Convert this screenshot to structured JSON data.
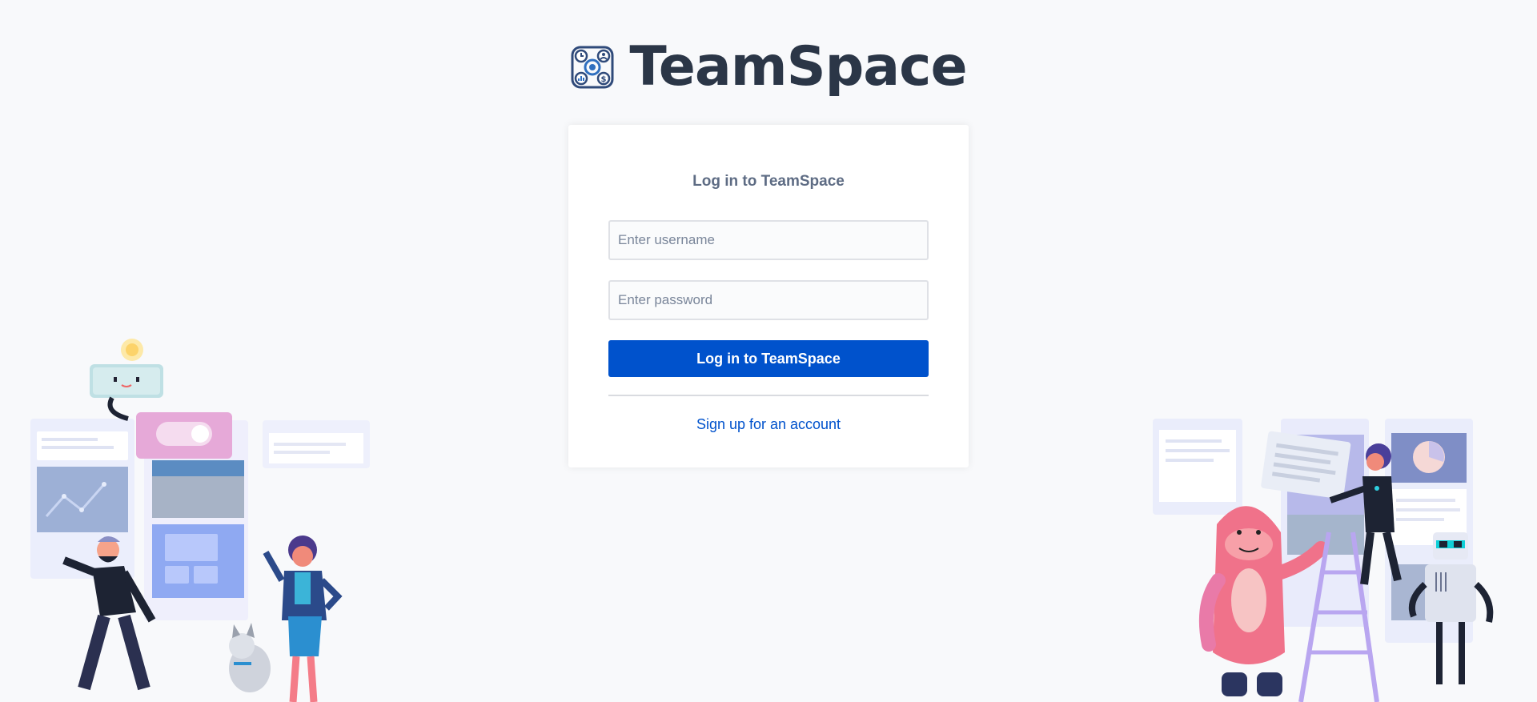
{
  "header": {
    "brand": "TeamSpace",
    "logo_icon": "teamspace-logo-icon"
  },
  "login": {
    "title": "Log in to TeamSpace",
    "username_placeholder": "Enter username",
    "username_value": "",
    "password_placeholder": "Enter password",
    "password_value": "",
    "submit_label": "Log in to TeamSpace",
    "signup_link": "Sign up for an account"
  },
  "colors": {
    "background": "#f8f9fb",
    "brand_text": "#2b3647",
    "primary_button": "#0052cc",
    "link": "#0052cc",
    "title": "#5e6c84"
  },
  "illustrations": {
    "left": "team-collaboration-illustration-left",
    "right": "team-collaboration-illustration-right"
  }
}
